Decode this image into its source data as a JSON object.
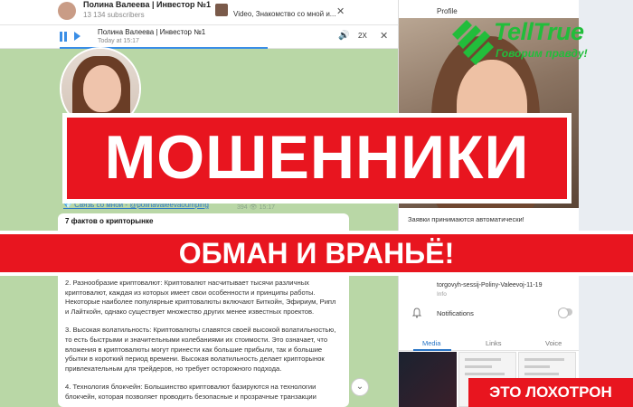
{
  "channel": {
    "name": "Полина Валеева | Инвестор №1",
    "subscribers": "13 134 subscribers",
    "pinned_video_text": "Video, Знакомство со мной и..."
  },
  "player": {
    "title": "Полина Валеева | Инвестор №1",
    "time": "Today at 15:17",
    "speed": "2X"
  },
  "post": {
    "link_text": "💎 Связь со мной - @polinavaleevaoumping",
    "views": "394",
    "time": "15:17",
    "title": "7 фактов о крипторынке",
    "para2": "2. Разнообразие криптовалют: Криптовалют насчитывает тысячи различных криптовалют, каждая из которых имеет свои особенности и принципы работы. Некоторые наиболее популярные криптовалюты включают Биткойн, Эфириум, Рипл и Лайткойн, однако существует множество других менее известных проектов.",
    "para3": "3. Высокая волатильность: Криптовалюты славятся своей высокой волатильностью, то есть быстрыми и значительными колебаниями их стоимости. Это означает, что вложения в криптовалюты могут принести как большие прибыли, так и большие убытки в короткий период времени. Высокая волатильность делает крипторынок привлекательным для трейдеров, но требует осторожного подхода.",
    "para4": "4. Технология блокчейн: Большинство криптовалют базируются на технологии блокчейн, которая позволяет проводить безопасные и прозрачные транзакции"
  },
  "profile": {
    "label": "Profile",
    "note": "Заявки принимаются автоматически!",
    "link": "torgovyh-sessij-Poliny-Valeevoj-11-19",
    "link_label": "Info",
    "notifications": "Notifications",
    "tabs": [
      {
        "label": "Media",
        "active": true
      },
      {
        "label": "Links",
        "active": false
      },
      {
        "label": "Voice",
        "active": false
      }
    ]
  },
  "logo": {
    "name": "TellTrue",
    "slogan": "Говорим правду!",
    "color": "#22bd3b"
  },
  "banners": {
    "main": "МОШЕННИКИ",
    "sub": "ОБМАН И ВРАНЬЁ!",
    "corner": "ЭТО ЛОХОТРОН",
    "color": "#e8151f"
  }
}
